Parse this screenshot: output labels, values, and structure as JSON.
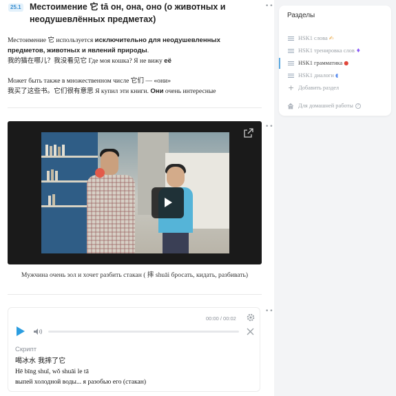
{
  "section": {
    "number": "25.1",
    "title": "Местоимение 它 tā он, она, оно (о животных и неодушевлённых предметах)"
  },
  "intro": {
    "line1_prefix": "Местоимение 它 используется ",
    "line1_bold": "исключительно для неодушевленных",
    "line2_bold": "предметов, животных и явлений природы",
    "line2_suffix": ".",
    "line3_text": "我的猫在哪儿？我没看见它 Где моя кошка? Я не вижу ",
    "line3_bold": "её"
  },
  "plural": {
    "line1": "Может быть также в множественном числе 它们 — «они»",
    "line2_text": "我买了这些书。它们很有意思  Я купил эти книги. ",
    "line2_bold": "Они",
    "line2_suffix": " очень интересные"
  },
  "video": {
    "caption": "Мужчина очень зол и хочет разбить стакан ( 摔  shuāi  бросать, кидать, разбивать)"
  },
  "audio": {
    "time": "00:00 / 00:02",
    "script_label": "Скрипт",
    "lines": [
      "喝冰水 我摔了它",
      "Hē bīng shuǐ, wǒ shuāi le tā",
      "выпей холодной воды... я разобью его (стакан)"
    ]
  },
  "sidebar": {
    "title": "Разделы",
    "items": [
      {
        "label": "HSK1 слова",
        "emoji": "✍"
      },
      {
        "label": "HSK1 тренировка слов",
        "emoji": "♦"
      },
      {
        "label": "HSK1 грамматика",
        "emoji": "●"
      },
      {
        "label": "HSK1 диалоги",
        "emoji": "◖"
      }
    ],
    "add_label": "Добавить раздел",
    "home_label": "Для домашней работы",
    "help_mark": "?"
  },
  "colors": {
    "accent": "#2b9de0",
    "section_badge_bg": "#e3f1fb",
    "sidebar_bg": "#f3f4f6"
  },
  "icons": [
    "more-dots-icon",
    "expand-icon",
    "play-icon",
    "volume-icon",
    "gear-icon",
    "close-icon",
    "menu-lines-icon",
    "plus-icon",
    "home-icon",
    "help-icon"
  ]
}
